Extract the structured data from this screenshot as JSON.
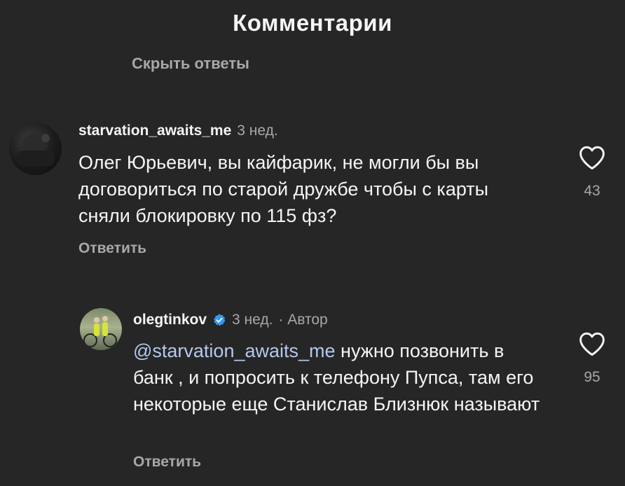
{
  "header": {
    "title": "Комментарии"
  },
  "hide_replies_label": "Скрыть ответы",
  "comments": [
    {
      "username": "starvation_awaits_me",
      "time": "3 нед.",
      "text": "Олег Юрьевич, вы кайфарик, не могли бы вы договориться по старой дружбе чтобы с карты сняли блокировку по 115 фз?",
      "reply_label": "Ответить",
      "likes": "43"
    },
    {
      "username": "olegtinkov",
      "verified": true,
      "time": "3 нед.",
      "author_label": "· Автор",
      "mention": "@starvation_awaits_me",
      "text": " нужно позвонить в банк , и попросить к телефону Пупса, там его некоторые еще Станислав Близнюк называют",
      "reply_label": "Ответить",
      "likes": "95"
    }
  ]
}
